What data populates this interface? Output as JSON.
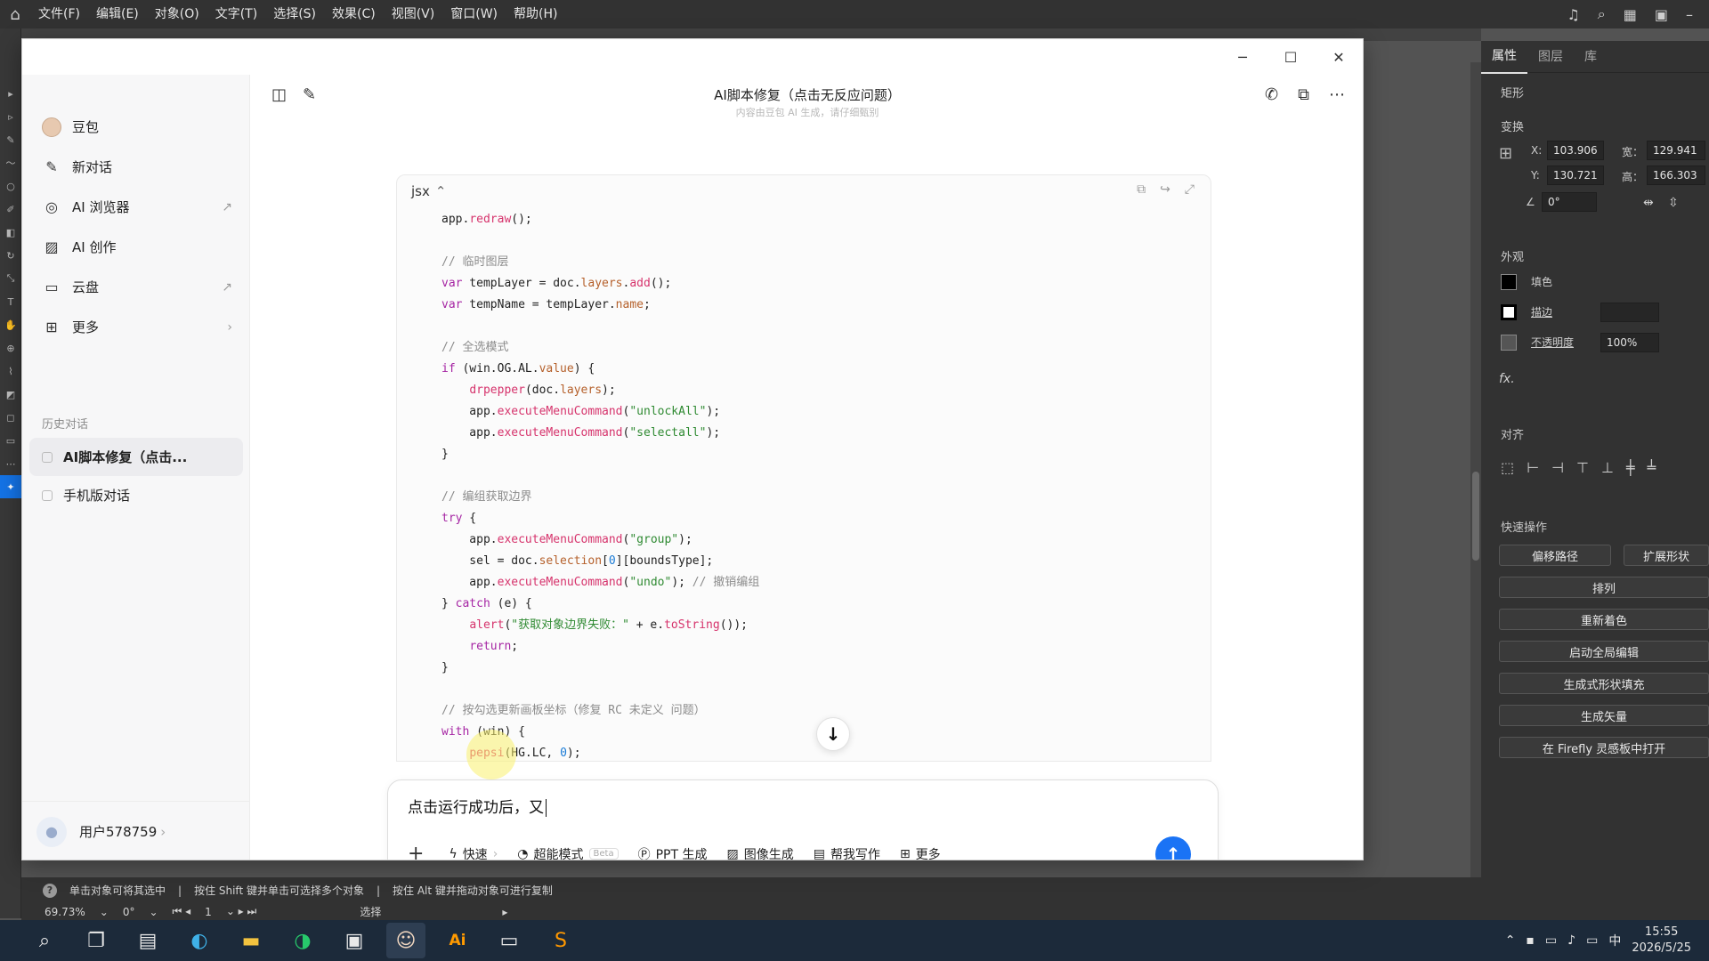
{
  "illustrator": {
    "menu": [
      "文件(F)",
      "编辑(E)",
      "对象(O)",
      "文字(T)",
      "选择(S)",
      "效果(C)",
      "视图(V)",
      "窗口(W)",
      "帮助(H)"
    ],
    "panel": {
      "tabs": [
        "属性",
        "图层",
        "库"
      ],
      "shape": "矩形",
      "transform": "变换",
      "x_label": "X:",
      "x_value": "103.906",
      "y_label": "Y:",
      "y_value": "130.721",
      "w_label": "宽：",
      "w_value": "129.941",
      "h_label": "高：",
      "h_value": "166.303",
      "angle": "0°",
      "appearance": "外观",
      "fill": "填色",
      "stroke": "描边",
      "opacity_label": "不透明度",
      "opacity_value": "100%",
      "fx": "fx.",
      "align": "对齐",
      "quick_actions": "快速操作",
      "btn_offset": "偏移路径",
      "btn_expand": "扩展形状",
      "btn_arrange": "排列",
      "btn_recolor": "重新着色",
      "btn_global_edit": "启动全局编辑",
      "btn_gen_fill": "生成式形状填充",
      "btn_gen_vector": "生成矢量",
      "btn_firefly": "在 Firefly 灵感板中打开"
    },
    "status": {
      "hint1": "单击对象可将其选中",
      "hint2": "按住 Shift 键并单击可选择多个对象",
      "hint3": "按住 Alt 键并拖动对象可进行复制",
      "zoom": "69.73%",
      "rotate": "0°",
      "artboard": "1",
      "mode": "选择"
    }
  },
  "window": {
    "header_title": "AI脚本修复（点击无反应问题）",
    "header_sub": "内容由豆包 AI 生成，请仔细甄别"
  },
  "sidebar": {
    "nav": [
      {
        "label": "豆包"
      },
      {
        "label": "新对话"
      },
      {
        "label": "AI 浏览器"
      },
      {
        "label": "AI 创作"
      },
      {
        "label": "云盘"
      },
      {
        "label": "更多"
      }
    ],
    "history_title": "历史对话",
    "history": [
      {
        "label": "AI脚本修复（点击..."
      },
      {
        "label": "手机版对话"
      }
    ],
    "user": "用户578759"
  },
  "code": {
    "lang": "jsx",
    "c1": "// 临时图层",
    "c2": "// 全选模式",
    "c3": "// 编组获取边界",
    "c4": "// 撤销编组",
    "c5": "// 按勾选更新画板坐标（修复 RC 未定义 问题）",
    "s1": "\"unlockAll\"",
    "s2": "\"selectall\"",
    "s3": "\"group\"",
    "s4": "\"undo\"",
    "s5": "\"获取对象边界失败：\""
  },
  "composer": {
    "text": "点击运行成功后，又",
    "tools": [
      "快速",
      "超能模式",
      "Beta",
      "PPT 生成",
      "图像生成",
      "帮我写作",
      "更多"
    ]
  },
  "taskbar": {
    "time": "15:55",
    "date": "2026/5/25",
    "ime": "中"
  }
}
